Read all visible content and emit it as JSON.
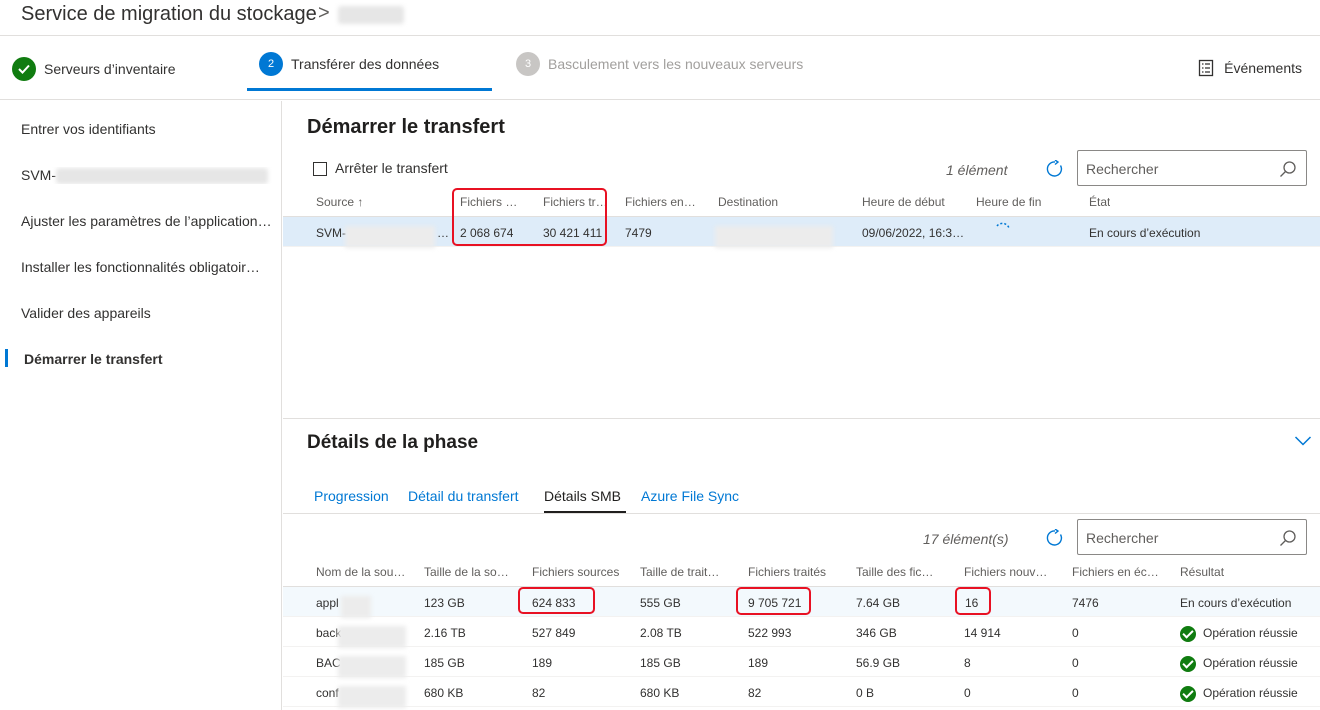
{
  "header": {
    "title": "Service de migration du stockage",
    "separator": ">"
  },
  "steps": [
    {
      "num": "",
      "label": "Serveurs d’inventaire",
      "state": "done"
    },
    {
      "num": "2",
      "label": "Transférer des données",
      "state": "current"
    },
    {
      "num": "3",
      "label": "Basculement vers les nouveaux serveurs",
      "state": "disabled"
    }
  ],
  "events_label": "Événements",
  "sidebar": {
    "items": [
      {
        "label": "Entrer vos identifiants"
      },
      {
        "label": "SVM-"
      },
      {
        "label": "Ajuster les paramètres de l’application…"
      },
      {
        "label": "Installer les fonctionnalités obligatoir…"
      },
      {
        "label": "Valider des appareils"
      },
      {
        "label": "Démarrer le transfert"
      }
    ]
  },
  "transfer": {
    "title": "Démarrer le transfert",
    "stop_label": "Arrêter le transfert",
    "count": "1 élément",
    "search_placeholder": "Rechercher",
    "columns": [
      "Source",
      "Fichiers s…",
      "Fichiers tr…",
      "Fichiers en …",
      "Destination",
      "Heure de début",
      "Heure de fin",
      "État"
    ],
    "row": {
      "source": "SVM-",
      "source_tail": "…",
      "files_source": "2 068 674",
      "files_transferred": "30 421 411",
      "files_error": "7479",
      "destination": "",
      "start": "09/06/2022, 16:3…",
      "end": "",
      "state": "En cours d’exécution"
    }
  },
  "phase": {
    "title": "Détails de la phase",
    "tabs": [
      "Progression",
      "Détail du transfert",
      "Détails SMB",
      "Azure File Sync"
    ],
    "active_tab": "Détails SMB",
    "count": "17 élément(s)",
    "search_placeholder": "Rechercher",
    "columns": [
      "Nom de la sou…",
      "Taille de la sou…",
      "Fichiers sources",
      "Taille de traite…",
      "Fichiers traités",
      "Taille des fichi…",
      "Fichiers nouve…",
      "Fichiers en éch…",
      "Résultat"
    ],
    "rows": [
      {
        "name": "appl",
        "size_src": "123 GB",
        "files_src": "624 833",
        "size_proc": "555 GB",
        "files_proc": "9 705 721",
        "size_files": "7.64 GB",
        "files_new": "16",
        "files_fail": "7476",
        "result": "En cours d’exécution",
        "ok": false
      },
      {
        "name": "back",
        "size_src": "2.16 TB",
        "files_src": "527 849",
        "size_proc": "2.08 TB",
        "files_proc": "522 993",
        "size_files": "346 GB",
        "files_new": "14 914",
        "files_fail": "0",
        "result": "Opération réussie",
        "ok": true
      },
      {
        "name": "BAC",
        "size_src": "185 GB",
        "files_src": "189",
        "size_proc": "185 GB",
        "files_proc": "189",
        "size_files": "56.9 GB",
        "files_new": "8",
        "files_fail": "0",
        "result": "Opération réussie",
        "ok": true
      },
      {
        "name": "conf",
        "size_src": "680 KB",
        "files_src": "82",
        "size_proc": "680 KB",
        "files_proc": "82",
        "size_files": "0 B",
        "files_new": "0",
        "files_fail": "0",
        "result": "Opération réussie",
        "ok": true
      }
    ]
  },
  "colors": {
    "accent": "#0078d4",
    "success": "#107c10",
    "highlight": "#e81123",
    "selected_row": "#deecf9"
  }
}
